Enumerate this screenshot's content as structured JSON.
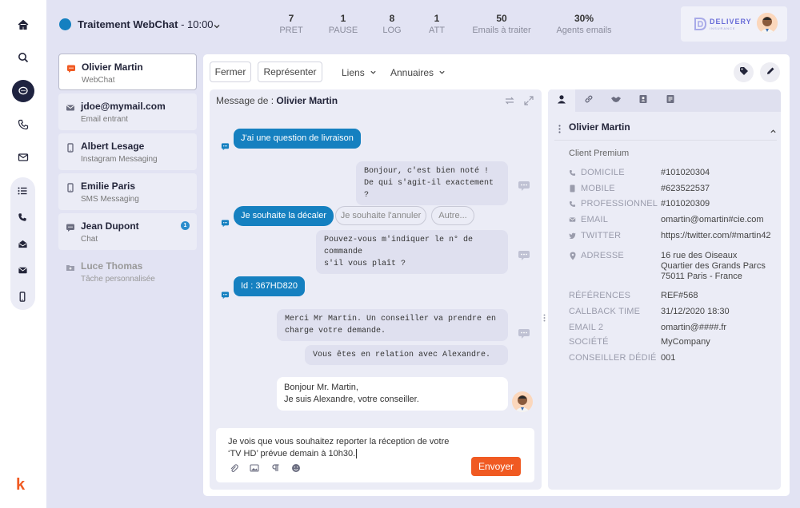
{
  "header": {
    "queue_name": "Traitement WebChat",
    "queue_time": " - 10:00",
    "stats": [
      {
        "value": "7",
        "label": "PRET"
      },
      {
        "value": "1",
        "label": "PAUSE"
      },
      {
        "value": "8",
        "label": "LOG"
      },
      {
        "value": "1",
        "label": "ATT"
      },
      {
        "value": "50",
        "label": "Emails à traiter"
      },
      {
        "value": "30%",
        "label": "Agents emails"
      }
    ],
    "brand_name": "DELIVERY",
    "brand_sub": "INSURANCE"
  },
  "rail": {
    "logo": "k"
  },
  "conversations": [
    {
      "name": "Olivier Martin",
      "channel": "WebChat",
      "icon": "chat-icon"
    },
    {
      "name": "jdoe@mymail.com",
      "channel": "Email entrant",
      "icon": "mail-icon"
    },
    {
      "name": "Albert Lesage",
      "channel": "Instagram Messaging",
      "icon": "phone-icon"
    },
    {
      "name": "Emilie Paris",
      "channel": "SMS Messaging",
      "icon": "phone-icon"
    },
    {
      "name": "Jean Dupont",
      "channel": "Chat",
      "icon": "chat-icon",
      "badge": "1"
    },
    {
      "name": "Luce Thomas",
      "channel": "Tâche personnalisée",
      "icon": "folder-icon"
    }
  ],
  "toolbar": {
    "close_label": "Fermer",
    "represent_label": "Représenter",
    "links_label": "Liens",
    "directories_label": "Annuaires"
  },
  "chat": {
    "header_prefix": "Message de : ",
    "header_name": "Olivier Martin",
    "msg1": "J'ai une question de livraison",
    "msg2_l1": "Bonjour, c'est bien noté !",
    "msg2_l2": "De qui s'agit-il exactement ?",
    "msg3": "Je souhaite la décaler",
    "quick1": "Je souhaite l'annuler",
    "quick2": "Autre...",
    "msg4_l1": "Pouvez-vous m'indiquer le n° de commande",
    "msg4_l2": "s'il vous plaît ?",
    "msg5": "Id : 367HD820",
    "msg6_l1": "Merci Mr Martin. Un conseiller va prendre en",
    "msg6_l2": "charge votre demande.",
    "msg7": "Vous êtes en relation avec Alexandre.",
    "msg8_l1": "Bonjour Mr. Martin,",
    "msg8_l2": "Je suis Alexandre, votre conseiller.",
    "composer_l1": "Je vois que vous souhaitez reporter la réception de votre",
    "composer_l2": "‘TV HD’ prévue demain à 10h30.",
    "send_label": "Envoyer"
  },
  "contact": {
    "name": "Olivier Martin",
    "segment": "Client Premium",
    "fields": [
      {
        "label": "DOMICILE",
        "value": "#101020304",
        "icon": "phone-icon"
      },
      {
        "label": "MOBILE",
        "value": "#623522537",
        "icon": "mobile-icon"
      },
      {
        "label": "PROFESSIONNEL",
        "value": "#101020309",
        "icon": "phone-icon"
      },
      {
        "label": "EMAIL",
        "value": "omartin@omartin#cie.com",
        "icon": "mail-icon"
      },
      {
        "label": "TWITTER",
        "value": "https://twitter.com/#martin42",
        "icon": "twitter-icon"
      }
    ],
    "address_label": "ADRESSE",
    "address_l1": "16 rue des Oiseaux",
    "address_l2": "Quartier des Grands Parcs",
    "address_l3": "75011 Paris - France",
    "extra": [
      {
        "label": "RÉFÉRENCES",
        "value": "REF#568"
      },
      {
        "label": "CALLBACK TIME",
        "value": "31/12/2020 18:30"
      },
      {
        "label": "EMAIL 2",
        "value": "omartin@####.fr"
      },
      {
        "label": "SOCIÉTÉ",
        "value": "MyCompany"
      },
      {
        "label": "CONSEILLER DÉDIÉ",
        "value": "001"
      }
    ]
  },
  "colors": {
    "accent": "#1580c0",
    "send": "#f05a22",
    "dark": "#1f2340"
  }
}
